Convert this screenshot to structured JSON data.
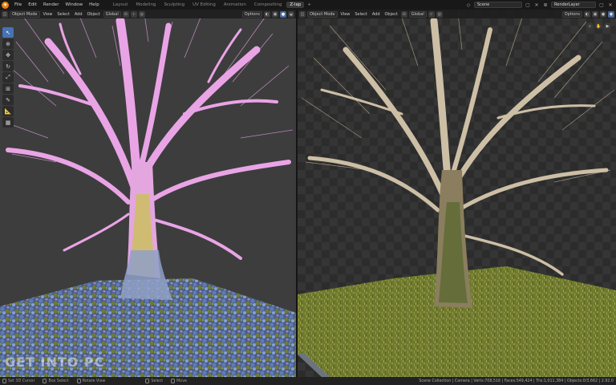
{
  "app": {
    "logo_icon": "blender-logo-icon"
  },
  "menu": [
    "File",
    "Edit",
    "Render",
    "Window",
    "Help"
  ],
  "workspaces": {
    "tabs": [
      "Layout",
      "Modeling",
      "Sculpting",
      "UV Editing",
      "Animation",
      "Compositing",
      "Z-lap"
    ],
    "active": "Z-lap",
    "add_label": "+"
  },
  "topbar": {
    "scene": "Scene",
    "render_layer": "RenderLayer"
  },
  "left_viewport": {
    "mode": "Object Mode",
    "menus": [
      "View",
      "Select",
      "Add",
      "Object"
    ],
    "orientation": "Global",
    "options": "Options",
    "tools": [
      "cursor-select-icon",
      "cursor-icon",
      "move-icon",
      "rotate-icon",
      "scale-icon",
      "transform-icon",
      "annotate-icon",
      "measure-icon",
      "add-cube-icon"
    ]
  },
  "right_viewport": {
    "mode": "Object Mode",
    "menus": [
      "View",
      "Select",
      "Add",
      "Object"
    ],
    "orientation": "Global",
    "options": "Options"
  },
  "watermark": "GET INTO PC",
  "statusbar": {
    "items": [
      "Set 3D Cursor",
      "Box Select",
      "Rotate View",
      "Select",
      "Move"
    ],
    "stats": "Scene Collection | Camera | Verts:708,516 | Faces:549,424 | Tris:1,011,384 | Objects:0/3,662 | 2.92.0"
  },
  "colors": {
    "accent": "#4772b3",
    "tree_overlay": "#e9a4e6",
    "ground_green": "#6f7a2e",
    "logo": "#e87d0d"
  }
}
